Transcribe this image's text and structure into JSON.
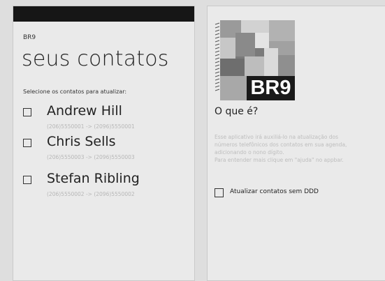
{
  "left_screen": {
    "app_title": "BR9",
    "page_title": "seus contatos",
    "instructions": "Selecione os contatos para atualizar:",
    "contacts": [
      {
        "name": "Andrew Hill",
        "phone": "(206)5550001 -> (2096)5550001",
        "checked": false
      },
      {
        "name": "Chris Sells",
        "phone": "(206)5550003 -> (2096)5550003",
        "checked": false
      },
      {
        "name": "Stefan Ribling",
        "phone": "(206)5550002 -> (2096)5550002",
        "checked": false
      }
    ]
  },
  "right_screen": {
    "logo_text": "BR9",
    "section_title": "O que é?",
    "description_lines": [
      "Esse aplicativo irá auxiliá-lo na atualização dos",
      "números telefônicos dos contatos em sua agenda,",
      "adicionando o nono dígito.",
      "Para entender mais clique em \"ajuda\" no appbar."
    ],
    "option_label": "Atualizar contatos sem DDD",
    "option_checked": false
  },
  "colors": {
    "background": "#dedede",
    "screen": "#eaeaea",
    "status_bar": "#161616",
    "muted_text": "#bdbdbd"
  }
}
